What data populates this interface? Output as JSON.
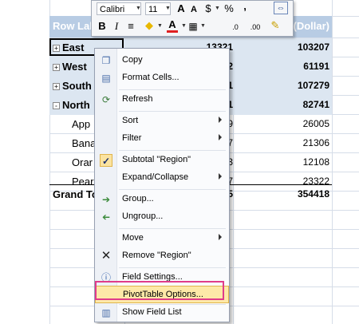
{
  "mini_toolbar": {
    "font_name": "Calibri",
    "font_size": "11",
    "buttons": {
      "grow_font": "A",
      "shrink_font": "A",
      "currency": "$",
      "percent": "%",
      "comma": ",",
      "bold": "B",
      "italic": "I",
      "center": "≡",
      "fill": "◆",
      "font_color": "A",
      "decimals_inc": ".0",
      "decimals_dec": ".00"
    }
  },
  "pivot": {
    "header_left": "Row Labe",
    "header_right": "e(Dollar)",
    "rows": [
      {
        "label": "East",
        "level": 0,
        "expander": "+",
        "mid": "13321",
        "value": "103207"
      },
      {
        "label": "West",
        "level": 0,
        "expander": "+",
        "mid": "2",
        "value": "61191"
      },
      {
        "label": "South",
        "level": 0,
        "expander": "+",
        "mid": "1",
        "value": "107279"
      },
      {
        "label": "North",
        "level": 0,
        "expander": "-",
        "mid": "1",
        "value": "82741"
      },
      {
        "label": "App",
        "level": 1,
        "expander": "",
        "mid": "9",
        "value": "26005"
      },
      {
        "label": "Bana",
        "level": 1,
        "expander": "",
        "mid": "7",
        "value": "21306"
      },
      {
        "label": "Orar",
        "level": 1,
        "expander": "",
        "mid": "3",
        "value": "12108"
      },
      {
        "label": "Pear",
        "level": 1,
        "expander": "",
        "mid": "7",
        "value": "23322"
      }
    ],
    "grand_total": {
      "label": "Grand To",
      "mid": "5",
      "value": "354418"
    }
  },
  "context_menu": {
    "items": [
      {
        "label": "Copy",
        "icon": "copy-icon"
      },
      {
        "label": "Format Cells...",
        "icon": "format-cells-icon"
      },
      {
        "label": "Refresh",
        "icon": "refresh-icon"
      },
      {
        "label": "Sort",
        "icon": ""
      },
      {
        "label": "Filter",
        "icon": ""
      },
      {
        "label": "Subtotal \"Region\"",
        "icon": "checkmark-icon"
      },
      {
        "label": "Expand/Collapse",
        "icon": ""
      },
      {
        "label": "Group...",
        "icon": "group-arrow-icon"
      },
      {
        "label": "Ungroup...",
        "icon": "ungroup-arrow-icon"
      },
      {
        "label": "Move",
        "icon": ""
      },
      {
        "label": "Remove \"Region\"",
        "icon": "remove-x-icon"
      },
      {
        "label": "Field Settings...",
        "icon": "field-settings-icon"
      },
      {
        "label": "PivotTable Options...",
        "icon": ""
      },
      {
        "label": "Show Field List",
        "icon": "field-list-icon"
      }
    ]
  },
  "colors": {
    "header_band": "#b8cce4",
    "row_band": "#dce6f1",
    "highlight": "#e03c8a",
    "menu_hover": "#fde9a8"
  }
}
